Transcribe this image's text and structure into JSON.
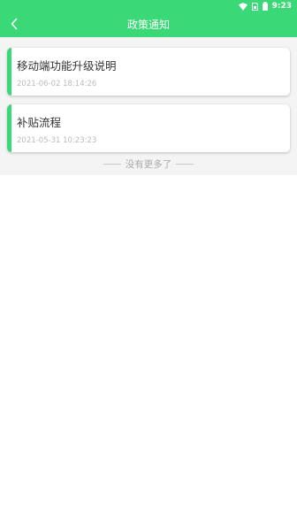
{
  "status_bar": {
    "time": "9:23",
    "icons": [
      "wifi-icon",
      "sim-icon",
      "battery-icon"
    ]
  },
  "header": {
    "title": "政策通知",
    "back_icon": "chevron-left-icon"
  },
  "notices": [
    {
      "title": "移动端功能升级说明",
      "time": "2021-06-02 18:14:26"
    },
    {
      "title": "补贴流程",
      "time": "2021-05-31 10:23:23"
    }
  ],
  "footer": {
    "no_more_text": "没有更多了"
  },
  "colors": {
    "brand_green": "#3ad877",
    "list_background": "#f4f4f4"
  }
}
